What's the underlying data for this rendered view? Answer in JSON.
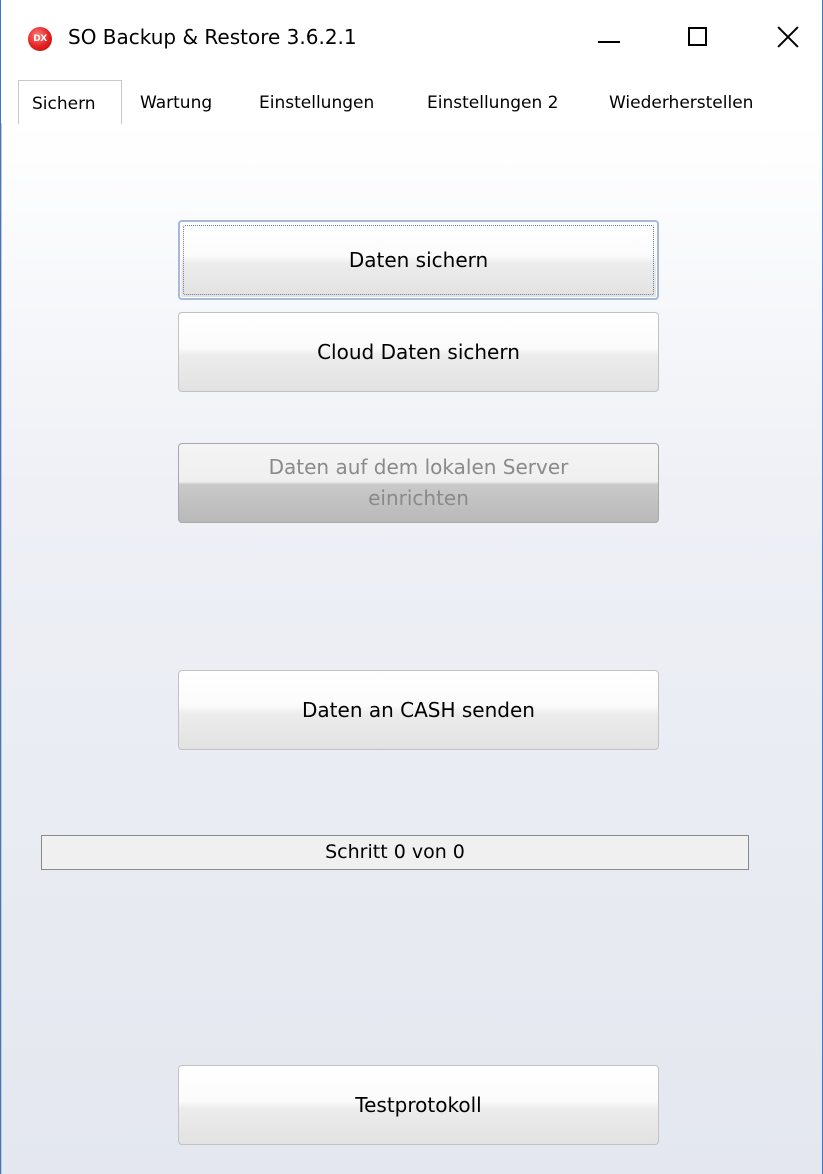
{
  "window": {
    "title": "SO Backup & Restore 3.6.2.1",
    "icon": "dx-app-icon",
    "icon_text": "DX",
    "controls": {
      "minimize": "minimize-icon",
      "maximize": "maximize-icon",
      "close": "close-icon"
    }
  },
  "tabs": [
    {
      "label": "Sichern",
      "active": true
    },
    {
      "label": "Wartung",
      "active": false
    },
    {
      "label": "Einstellungen",
      "active": false
    },
    {
      "label": "Einstellungen 2",
      "active": false
    },
    {
      "label": "Wiederherstellen",
      "active": false
    }
  ],
  "main": {
    "backup_button": "Daten sichern",
    "cloud_backup_button": "Cloud Daten sichern",
    "local_server_button": {
      "line1": "Daten auf dem lokalen Server",
      "line2": "einrichten",
      "enabled": false
    },
    "send_cash_button": "Daten an CASH senden",
    "progress_text": "Schritt 0 von 0",
    "test_log_button": "Testprotokoll"
  }
}
